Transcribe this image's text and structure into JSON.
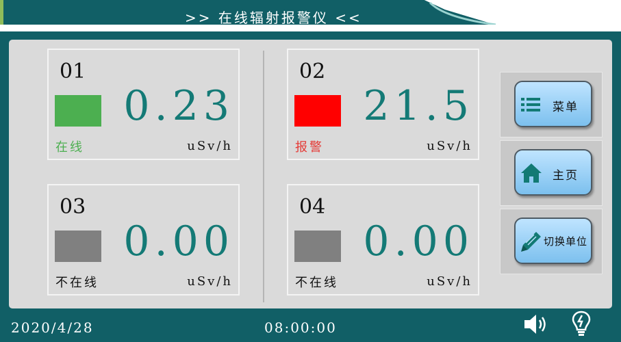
{
  "header": {
    "title": ">> 在线辐射报警仪 <<"
  },
  "channels": [
    {
      "id": "01",
      "value": "0.23",
      "unit": "uSv/h",
      "status": "在线",
      "status_color": "#4caf50",
      "indicator_color": "#4caf50"
    },
    {
      "id": "02",
      "value": "21.5",
      "unit": "uSv/h",
      "status": "报警",
      "status_color": "#e53935",
      "indicator_color": "#ff0000"
    },
    {
      "id": "03",
      "value": "0.00",
      "unit": "uSv/h",
      "status": "不在线",
      "status_color": "#111111",
      "indicator_color": "#808080"
    },
    {
      "id": "04",
      "value": "0.00",
      "unit": "uSv/h",
      "status": "不在线",
      "status_color": "#111111",
      "indicator_color": "#808080"
    }
  ],
  "buttons": [
    {
      "label": "菜单",
      "icon": "list-icon"
    },
    {
      "label": "主页",
      "icon": "home-icon"
    },
    {
      "label": "切换单位",
      "icon": "pencil-icon"
    }
  ],
  "footer": {
    "date": "2020/4/28",
    "time": "08:00:00"
  },
  "icons": {
    "speaker": "speaker-icon",
    "bulb": "bulb-icon"
  },
  "colors": {
    "frame": "#115f66",
    "panel": "#dadada",
    "value": "#147a76",
    "button": "#9fd3f7"
  }
}
